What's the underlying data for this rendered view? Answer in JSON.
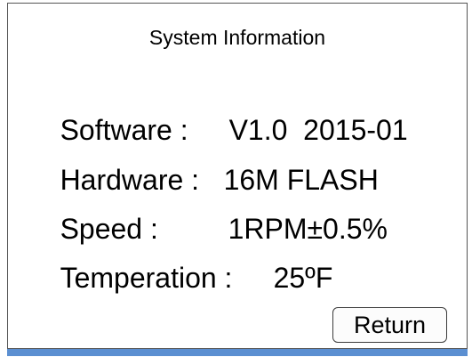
{
  "dialog": {
    "title": "System Information",
    "rows": [
      {
        "label": "Software :",
        "value": "V1.0  2015-01"
      },
      {
        "label": "Hardware :",
        "value": "16M FLASH"
      },
      {
        "label": "Speed :",
        "value": "1RPM±0.5%"
      },
      {
        "label": "Temperation :",
        "value": "25ºF"
      }
    ],
    "return_label": "Return"
  },
  "colors": {
    "border": "#555555",
    "bottom_bar": "#5b8fd1",
    "background": "#ffffff"
  }
}
